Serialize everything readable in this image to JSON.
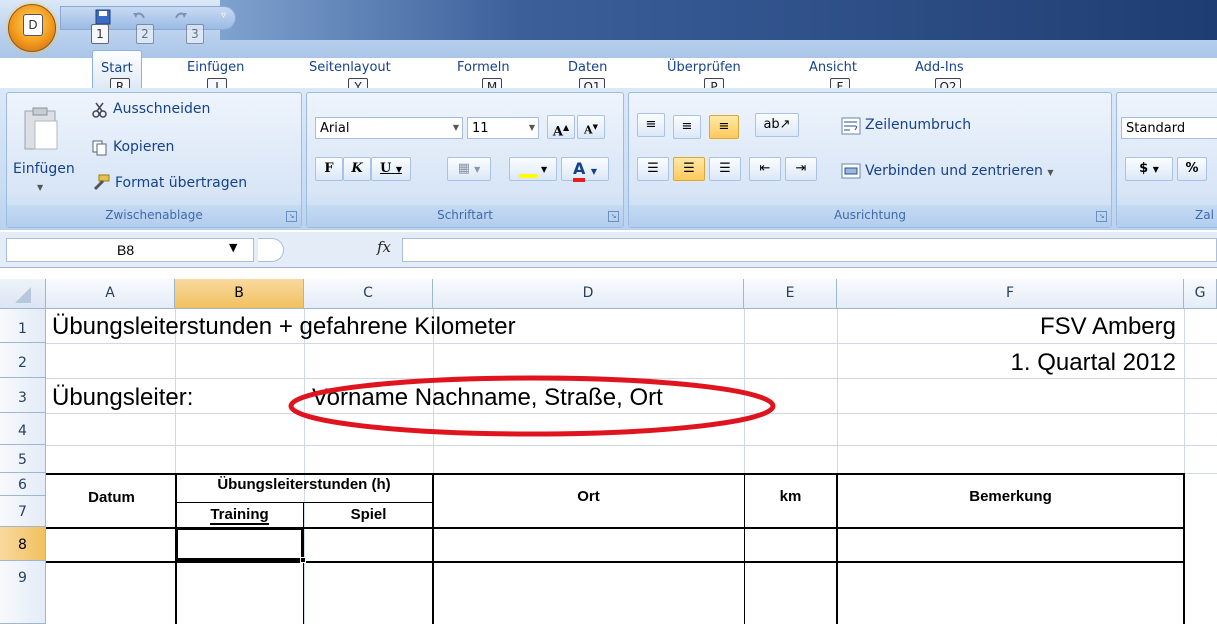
{
  "qat": {
    "office_key": "D",
    "keys": [
      "1",
      "2",
      "3"
    ]
  },
  "tabs": [
    {
      "label": "Start",
      "key": "R"
    },
    {
      "label": "Einfügen",
      "key": "I"
    },
    {
      "label": "Seitenlayout",
      "key": "Y"
    },
    {
      "label": "Formeln",
      "key": "M"
    },
    {
      "label": "Daten",
      "key": "Q1"
    },
    {
      "label": "Überprüfen",
      "key": "P"
    },
    {
      "label": "Ansicht",
      "key": "F"
    },
    {
      "label": "Add-Ins",
      "key": "Q2"
    }
  ],
  "clipboard": {
    "paste": "Einfügen",
    "cut": "Ausschneiden",
    "copy": "Kopieren",
    "format_painter": "Format übertragen",
    "group": "Zwischenablage"
  },
  "font": {
    "name": "Arial",
    "size": "11",
    "bold": "F",
    "italic": "K",
    "underline": "U",
    "grow": "A",
    "shrink": "A",
    "font_color": "A",
    "group": "Schriftart"
  },
  "alignment": {
    "wrap": "Zeilenumbruch",
    "merge": "Verbinden und zentrieren",
    "group": "Ausrichtung"
  },
  "number": {
    "format": "Standard",
    "currency": "$",
    "percent": "%",
    "group": "Zal"
  },
  "formula_bar": {
    "cell_ref": "B8",
    "fx": "fx"
  },
  "columns": [
    "A",
    "B",
    "C",
    "D",
    "E",
    "F",
    "G"
  ],
  "rows": [
    "1",
    "2",
    "3",
    "4",
    "5",
    "6",
    "7",
    "8",
    "9"
  ],
  "cells": {
    "title": "Übungsleiterstunden + gefahrene Kilometer",
    "club": "FSV Amberg",
    "quarter": "1. Quartal 2012",
    "trainer_label": "Übungsleiter:",
    "trainer_value": "Vorname Nachname, Straße, Ort",
    "h_datum": "Datum",
    "h_hours": "Übungsleiterstunden (h)",
    "h_training": "Training",
    "h_spiel": "Spiel",
    "h_ort": "Ort",
    "h_km": "km",
    "h_bemerkung": "Bemerkung"
  },
  "colors": {
    "annotation": "#e0141e",
    "selected_header": "#f1c15f",
    "ribbon": "#c9dcf3"
  }
}
